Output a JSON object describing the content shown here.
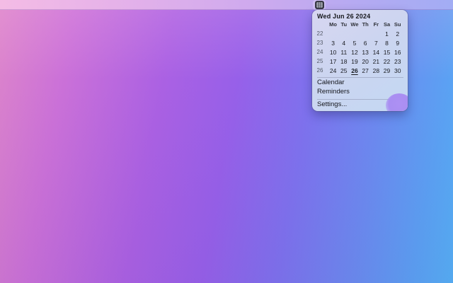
{
  "menubar": {
    "clock_button_icon": "calendar-grid-icon"
  },
  "popover": {
    "header": "Wed Jun 26 2024",
    "day_headers": [
      "Mo",
      "Tu",
      "We",
      "Th",
      "Fr",
      "Sa",
      "Su"
    ],
    "weeks": [
      {
        "num": "22",
        "days": [
          "",
          "",
          "",
          "",
          "",
          "1",
          "2"
        ]
      },
      {
        "num": "23",
        "days": [
          "3",
          "4",
          "5",
          "6",
          "7",
          "8",
          "9"
        ]
      },
      {
        "num": "24",
        "days": [
          "10",
          "11",
          "12",
          "13",
          "14",
          "15",
          "16"
        ]
      },
      {
        "num": "25",
        "days": [
          "17",
          "18",
          "19",
          "20",
          "21",
          "22",
          "23"
        ]
      },
      {
        "num": "26",
        "days": [
          "24",
          "25",
          "26",
          "27",
          "28",
          "29",
          "30"
        ]
      }
    ],
    "today": "26",
    "menu_items": [
      {
        "label": "Calendar"
      },
      {
        "label": "Reminders"
      }
    ],
    "settings_label": "Settings...",
    "colors": {
      "corner_blob": "#a98ef2",
      "wallpaper_stops": [
        "#dd85ca",
        "#9760e9",
        "#55b0f5"
      ]
    }
  }
}
